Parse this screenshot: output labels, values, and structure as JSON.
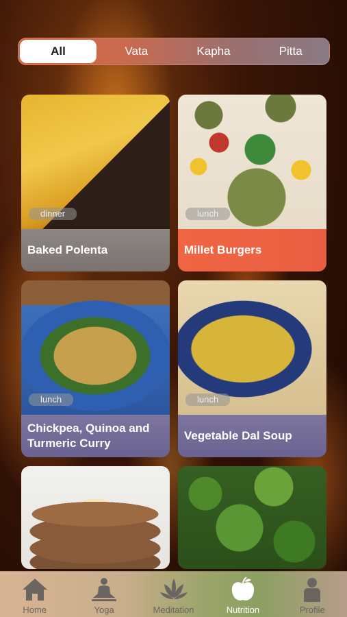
{
  "filters": {
    "active": "All",
    "items": [
      "All",
      "Vata",
      "Kapha",
      "Pitta"
    ]
  },
  "recipes": [
    {
      "title": "Baked Polenta",
      "tag": "dinner",
      "style": "gray",
      "image": "polenta-image"
    },
    {
      "title": "Millet Burgers",
      "tag": "lunch",
      "style": "orange",
      "image": "burgers-image"
    },
    {
      "title": "Chickpea, Quinoa and Turmeric Curry",
      "tag": "lunch",
      "style": "violet",
      "image": "curry-image"
    },
    {
      "title": "Vegetable Dal Soup",
      "tag": "lunch",
      "style": "violet",
      "image": "soup-image"
    },
    {
      "title": "",
      "tag": "",
      "style": "gray",
      "image": "pancakes-image"
    },
    {
      "title": "",
      "tag": "",
      "style": "gray",
      "image": "greens-image"
    }
  ],
  "tabbar": {
    "items": [
      {
        "label": "Home",
        "icon": "home-icon"
      },
      {
        "label": "Yoga",
        "icon": "yoga-icon"
      },
      {
        "label": "Meditation",
        "icon": "lotus-icon"
      },
      {
        "label": "Nutrition",
        "icon": "apple-icon"
      },
      {
        "label": "Profile",
        "icon": "person-icon"
      }
    ],
    "active": "Nutrition"
  },
  "colors": {
    "accent_orange": "#f06644",
    "caption_gray": "#8e8683",
    "caption_violet": "#7e76a0"
  }
}
